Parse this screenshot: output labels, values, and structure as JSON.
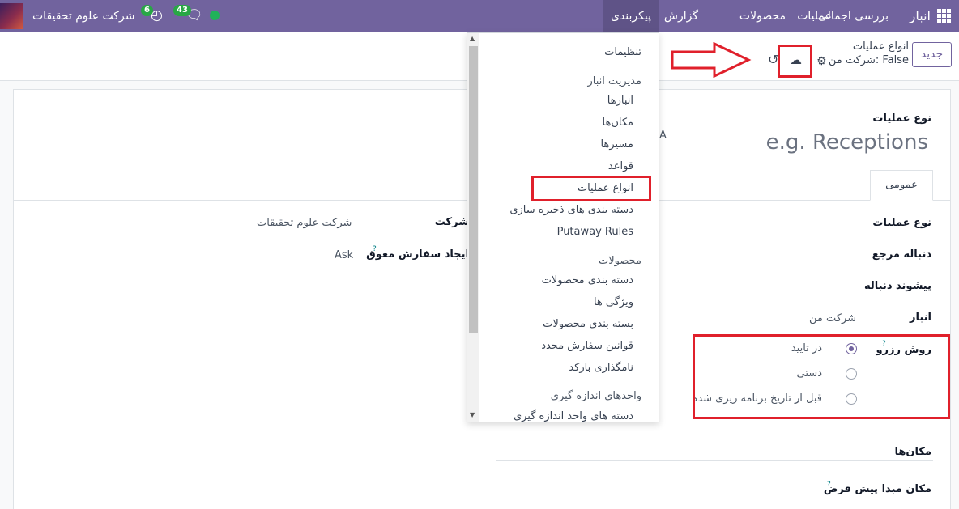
{
  "navbar": {
    "app_name": "انبار",
    "menu": [
      "بررسی اجمالی",
      "عملیات",
      "محصولات",
      "گزارش",
      "پیکربندی"
    ],
    "active_menu": "پیکربندی",
    "company": "شرکت علوم تحقیقات",
    "messages_count": "43",
    "activities_count": "6",
    "icons": [
      "apps-grid-icon",
      "chat-icon",
      "clock-icon",
      "presence-dot",
      "company-avatar"
    ]
  },
  "control_panel": {
    "new_button": "جدید",
    "breadcrumb_parent": "انواع عملیات",
    "breadcrumb_record": "شرکت من: False"
  },
  "form": {
    "title_label": "نوع عملیات",
    "title_placeholder": "e.g. Receptions",
    "partial_letter": "A",
    "tab_general": "عمومی",
    "operation_type_label": "نوع عملیات",
    "sequence_label": "دنباله مرجع",
    "sequence_prefix_label": "پیشوند دنباله",
    "warehouse_label": "انبار",
    "warehouse_value": "شرکت من",
    "reservation_label": "روش رزرو",
    "reservation_options": [
      "در تایید",
      "دستی",
      "قبل از تاریخ برنامه ریزی شده"
    ],
    "reservation_selected": "در تایید",
    "company_label": "شرکت",
    "company_value": "شرکت علوم تحقیقات",
    "backorder_label": "ایجاد سفارش معوق",
    "backorder_value": "Ask",
    "locations_section": "مکان‌ها",
    "default_source_label": "مکان مبدا پیش فرض",
    "help_mark": "?"
  },
  "dropdown": {
    "settings": "تنظیمات",
    "sections": [
      {
        "header": "مدیریت انبار",
        "items": [
          "انبارها",
          "مکان‌ها",
          "مسیرها",
          "قواعد",
          "انواع عملیات",
          "دسته بندی های ذخیره سازی",
          "Putaway Rules"
        ]
      },
      {
        "header": "محصولات",
        "items": [
          "دسته بندی محصولات",
          "ویژگی ها",
          "بسته بندی محصولات",
          "قوانین سفارش مجدد",
          "نامگذاری بارکد"
        ]
      },
      {
        "header": "واحدهای اندازه گیری",
        "items": [
          "دسته های واحد اندازه گیری"
        ]
      }
    ],
    "highlighted_item": "انواع عملیات"
  },
  "colors": {
    "navbar": "#71639e",
    "annotation_red": "#e0202b",
    "badge_green": "#28a745"
  }
}
